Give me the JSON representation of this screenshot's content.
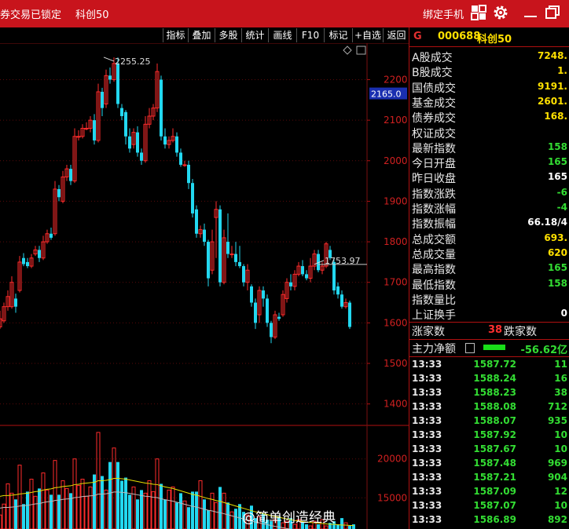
{
  "titlebar": {
    "status": "券交易已锁定",
    "security": "科创50",
    "bind_phone": "绑定手机"
  },
  "toolbar": [
    "指标",
    "叠加",
    "多股",
    "统计",
    "画线",
    "F10",
    "标记",
    "+自选",
    "返回"
  ],
  "colors": {
    "up": "#ff2b2b",
    "down": "#22d8f0",
    "accent": "#c8141c",
    "green": "#33dd33",
    "yellow": "#ffe000"
  },
  "chart_data": [
    {
      "type": "candlestick",
      "y_ticks": [
        "2200",
        "2100",
        "2000",
        "1900",
        "1800",
        "1700",
        "1600",
        "1500",
        "1400"
      ],
      "ylim": [
        1380,
        2290
      ],
      "current_price_label": "2165.0",
      "annotations": [
        {
          "label": "2255.25",
          "price": 2255.25
        },
        {
          "label": "1753.97",
          "price": 1753.97
        }
      ],
      "candles": [
        [
          1590,
          1610,
          1585,
          1630
        ],
        [
          1605,
          1640,
          1600,
          1650
        ],
        [
          1640,
          1665,
          1630,
          1680
        ],
        [
          1640,
          1700,
          1635,
          1715
        ],
        [
          1660,
          1640,
          1625,
          1672
        ],
        [
          1680,
          1750,
          1675,
          1765
        ],
        [
          1760,
          1745,
          1740,
          1772
        ],
        [
          1750,
          1740,
          1735,
          1760
        ],
        [
          1740,
          1760,
          1735,
          1770
        ],
        [
          1770,
          1780,
          1765,
          1790
        ],
        [
          1780,
          1760,
          1750,
          1790
        ],
        [
          1760,
          1800,
          1755,
          1815
        ],
        [
          1800,
          1820,
          1795,
          1830
        ],
        [
          1820,
          1810,
          1805,
          1835
        ],
        [
          1820,
          1930,
          1815,
          1950
        ],
        [
          1930,
          1910,
          1900,
          1940
        ],
        [
          1900,
          1960,
          1895,
          1975
        ],
        [
          1960,
          1980,
          1950,
          1990
        ],
        [
          1980,
          1950,
          1940,
          1990
        ],
        [
          1950,
          2060,
          1945,
          2080
        ],
        [
          2060,
          2060,
          2050,
          2075
        ],
        [
          2060,
          2080,
          2055,
          2090
        ],
        [
          2080,
          2080,
          2075,
          2095
        ],
        [
          2080,
          2100,
          2070,
          2110
        ],
        [
          2100,
          2050,
          2040,
          2115
        ],
        [
          2050,
          2170,
          2045,
          2190
        ],
        [
          2170,
          2130,
          2110,
          2180
        ],
        [
          2140,
          2210,
          2130,
          2225
        ],
        [
          2210,
          2200,
          2190,
          2230
        ],
        [
          2200,
          2240,
          2195,
          2255
        ],
        [
          2240,
          2140,
          2130,
          2255
        ],
        [
          2130,
          2110,
          2100,
          2140
        ],
        [
          2120,
          2060,
          2040,
          2125
        ],
        [
          2060,
          2030,
          2020,
          2080
        ],
        [
          2040,
          2070,
          2030,
          2080
        ],
        [
          2070,
          2020,
          2010,
          2085
        ],
        [
          2020,
          2000,
          1990,
          2030
        ],
        [
          2000,
          2090,
          1995,
          2110
        ],
        [
          2090,
          2110,
          2080,
          2130
        ],
        [
          2110,
          2130,
          2100,
          2140
        ],
        [
          2130,
          2220,
          2120,
          2240
        ],
        [
          2200,
          2060,
          2050,
          2210
        ],
        [
          2060,
          2040,
          2030,
          2080
        ],
        [
          2040,
          2050,
          2030,
          2060
        ],
        [
          2050,
          2060,
          2045,
          2080
        ],
        [
          2060,
          2020,
          2010,
          2070
        ],
        [
          2020,
          1990,
          1985,
          2030
        ],
        [
          1990,
          1990,
          1985,
          2000
        ],
        [
          1990,
          1945,
          1930,
          2000
        ],
        [
          1945,
          1870,
          1860,
          1955
        ],
        [
          1880,
          1820,
          1810,
          1890
        ],
        [
          1820,
          1830,
          1810,
          1840
        ],
        [
          1830,
          1800,
          1790,
          1845
        ],
        [
          1800,
          1710,
          1690,
          1805
        ],
        [
          1730,
          1800,
          1720,
          1830
        ],
        [
          1860,
          1880,
          1760,
          1900
        ],
        [
          1880,
          1700,
          1690,
          1890
        ],
        [
          1700,
          1810,
          1695,
          1830
        ],
        [
          1800,
          1770,
          1760,
          1870
        ],
        [
          1770,
          1770,
          1760,
          1790
        ],
        [
          1770,
          1750,
          1740,
          1800
        ],
        [
          1750,
          1740,
          1735,
          1790
        ],
        [
          1740,
          1700,
          1690,
          1745
        ],
        [
          1700,
          1730,
          1680,
          1745
        ],
        [
          1690,
          1650,
          1640,
          1695
        ],
        [
          1650,
          1600,
          1585,
          1660
        ],
        [
          1620,
          1680,
          1600,
          1690
        ],
        [
          1680,
          1660,
          1640,
          1690
        ],
        [
          1660,
          1600,
          1590,
          1670
        ],
        [
          1600,
          1565,
          1550,
          1605
        ],
        [
          1565,
          1620,
          1560,
          1630
        ],
        [
          1615,
          1610,
          1605,
          1625
        ],
        [
          1620,
          1670,
          1615,
          1680
        ],
        [
          1660,
          1700,
          1650,
          1710
        ],
        [
          1700,
          1690,
          1680,
          1720
        ],
        [
          1690,
          1720,
          1680,
          1730
        ],
        [
          1720,
          1740,
          1715,
          1750
        ],
        [
          1740,
          1720,
          1715,
          1755
        ],
        [
          1720,
          1710,
          1705,
          1730
        ],
        [
          1710,
          1740,
          1700,
          1760
        ],
        [
          1740,
          1770,
          1730,
          1780
        ],
        [
          1770,
          1730,
          1725,
          1780
        ],
        [
          1730,
          1740,
          1720,
          1750
        ],
        [
          1740,
          1795,
          1735,
          1800
        ],
        [
          1780,
          1760,
          1755,
          1790
        ],
        [
          1750,
          1680,
          1670,
          1760
        ],
        [
          1690,
          1670,
          1660,
          1700
        ],
        [
          1670,
          1640,
          1635,
          1680
        ],
        [
          1640,
          1650,
          1635,
          1660
        ],
        [
          1650,
          1590,
          1585,
          1655
        ]
      ]
    },
    {
      "type": "bar",
      "name": "volume",
      "y_ticks": [
        "20000",
        "15000"
      ],
      "ylim": [
        11000,
        24000
      ],
      "values": [
        12800,
        14200,
        16800,
        15600,
        14800,
        19200,
        14200,
        15800,
        17400,
        15200,
        16200,
        18200,
        16000,
        15400,
        19800,
        15400,
        17200,
        16200,
        15600,
        20000,
        16600,
        17400,
        15200,
        16400,
        18000,
        23400,
        17800,
        16000,
        19600,
        21400,
        19600,
        17200,
        17600,
        15400,
        16400,
        14800,
        16000,
        15600,
        17200,
        15800,
        20000,
        16800,
        14800,
        16000,
        16400,
        14400,
        15600,
        14600,
        13800,
        15800,
        15800,
        17200,
        14800,
        13400,
        15600,
        14400,
        16400,
        15600,
        14400,
        13200,
        13600,
        14200,
        13200,
        12800,
        14000,
        12400,
        12600,
        13000,
        12200,
        12000,
        12200,
        12600,
        11800,
        12000,
        12400,
        11600,
        12200,
        11800,
        11600,
        11400,
        12000,
        11600,
        12200,
        11400,
        11800,
        12000,
        11600,
        12400,
        11800,
        11400,
        11600
      ],
      "ma_values": [
        15200,
        15300,
        15300,
        15350,
        15400,
        15500,
        15550,
        15600,
        15700,
        15800,
        15850,
        16000,
        16100,
        16150,
        16300,
        16350,
        16450,
        16500,
        16550,
        16700,
        16750,
        16850,
        16900,
        16950,
        17000,
        17200,
        17200,
        17250,
        17350,
        17500,
        17500,
        17450,
        17400,
        17300,
        17200,
        17100,
        17000,
        16900,
        16850,
        16750,
        16700,
        16550,
        16400,
        16300,
        16200,
        16050,
        15900,
        15750,
        15600,
        15450,
        15350,
        15200,
        15050,
        14900,
        14800,
        14650,
        14550,
        14400,
        14250,
        14100,
        13950,
        13800,
        13650,
        13500,
        13350,
        13200,
        13100,
        12950,
        12850,
        12700,
        12600,
        12500,
        12400,
        12300,
        12200,
        12100,
        12050,
        11950,
        11900,
        11850,
        11800,
        11750,
        11700,
        11650,
        11600,
        11600,
        11550,
        11500,
        11500,
        11450,
        11450
      ]
    }
  ],
  "panel": {
    "g": "G",
    "code": "000688",
    "name": "科创50",
    "stats": [
      {
        "label": "A股成交",
        "value": "7248.",
        "color": "#ffe000"
      },
      {
        "label": "B股成交",
        "value": "1.",
        "color": "#ffe000"
      },
      {
        "label": "国债成交",
        "value": "9191.",
        "color": "#ffe000"
      },
      {
        "label": "基金成交",
        "value": "2601.",
        "color": "#ffe000"
      },
      {
        "label": "债券成交",
        "value": "168.",
        "color": "#ffe000"
      },
      {
        "label": "权证成交",
        "value": "",
        "color": "#ffe000"
      },
      {
        "label": "最新指数",
        "value": "158",
        "color": "#33dd33"
      },
      {
        "label": "今日开盘",
        "value": "165",
        "color": "#33dd33"
      },
      {
        "label": "昨日收盘",
        "value": "165",
        "color": "#ffffff"
      },
      {
        "label": "指数涨跌",
        "value": "-6",
        "color": "#33dd33"
      },
      {
        "label": "指数涨幅",
        "value": "-4",
        "color": "#33dd33"
      },
      {
        "label": "指数振幅",
        "value": "66.18/4",
        "color": "#ffffff"
      },
      {
        "label": "总成交额",
        "value": "693.",
        "color": "#ffe000"
      },
      {
        "label": "总成交量",
        "value": "620",
        "color": "#ffe000"
      },
      {
        "label": "最高指数",
        "value": "165",
        "color": "#33dd33"
      },
      {
        "label": "最低指数",
        "value": "158",
        "color": "#33dd33"
      },
      {
        "label": "指数量比",
        "value": "",
        "color": "#ffffff"
      },
      {
        "label": "上证换手",
        "value": "0",
        "color": "#ffffff"
      }
    ],
    "rise_label": "涨家数",
    "rise_count": "38",
    "fall_label": "跌家数",
    "main_flow_label": "主力净额",
    "main_flow_value": "-56.62亿",
    "ticks": [
      {
        "time": "13:33",
        "price": "1587.72",
        "vol": "11"
      },
      {
        "time": "13:33",
        "price": "1588.24",
        "vol": "16"
      },
      {
        "time": "13:33",
        "price": "1588.23",
        "vol": "38"
      },
      {
        "time": "13:33",
        "price": "1588.08",
        "vol": "712"
      },
      {
        "time": "13:33",
        "price": "1588.07",
        "vol": "935"
      },
      {
        "time": "13:33",
        "price": "1587.92",
        "vol": "10"
      },
      {
        "time": "13:33",
        "price": "1587.67",
        "vol": "10"
      },
      {
        "time": "13:33",
        "price": "1587.48",
        "vol": "969"
      },
      {
        "time": "13:33",
        "price": "1587.21",
        "vol": "904"
      },
      {
        "time": "13:33",
        "price": "1587.09",
        "vol": "12"
      },
      {
        "time": "13:33",
        "price": "1587.07",
        "vol": "10"
      },
      {
        "time": "13:33",
        "price": "1586.89",
        "vol": "892"
      }
    ]
  },
  "watermark": "@简单创造经典"
}
